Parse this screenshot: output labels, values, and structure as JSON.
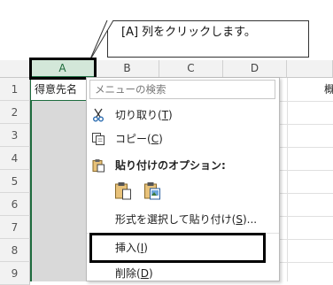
{
  "callout": {
    "text": "[A] 列をクリックします。"
  },
  "sheet": {
    "columns": [
      "A",
      "B",
      "C",
      "D"
    ],
    "rows": [
      "1",
      "2",
      "3",
      "4",
      "5",
      "6",
      "7",
      "8",
      "9"
    ],
    "a1_value": "得意先名",
    "e1_partial": "概"
  },
  "context_menu": {
    "search_placeholder": "メニューの検索",
    "cut": {
      "label": "切り取り(",
      "key": "T",
      "tail": ")"
    },
    "copy": {
      "label": "コピー(",
      "key": "C",
      "tail": ")"
    },
    "paste_options": {
      "label": "貼り付けのオプション:"
    },
    "paste_special": {
      "label": "形式を選択して貼り付け(",
      "key": "S",
      "tail": ")..."
    },
    "insert": {
      "label": "挿入(",
      "key": "I",
      "tail": ")"
    },
    "delete": {
      "label": "削除(",
      "key": "D",
      "tail": ")"
    }
  },
  "colors": {
    "selection_green": "#217346",
    "header_gray": "#f2f2f2",
    "selected_column_fill": "#d9d9d9"
  }
}
